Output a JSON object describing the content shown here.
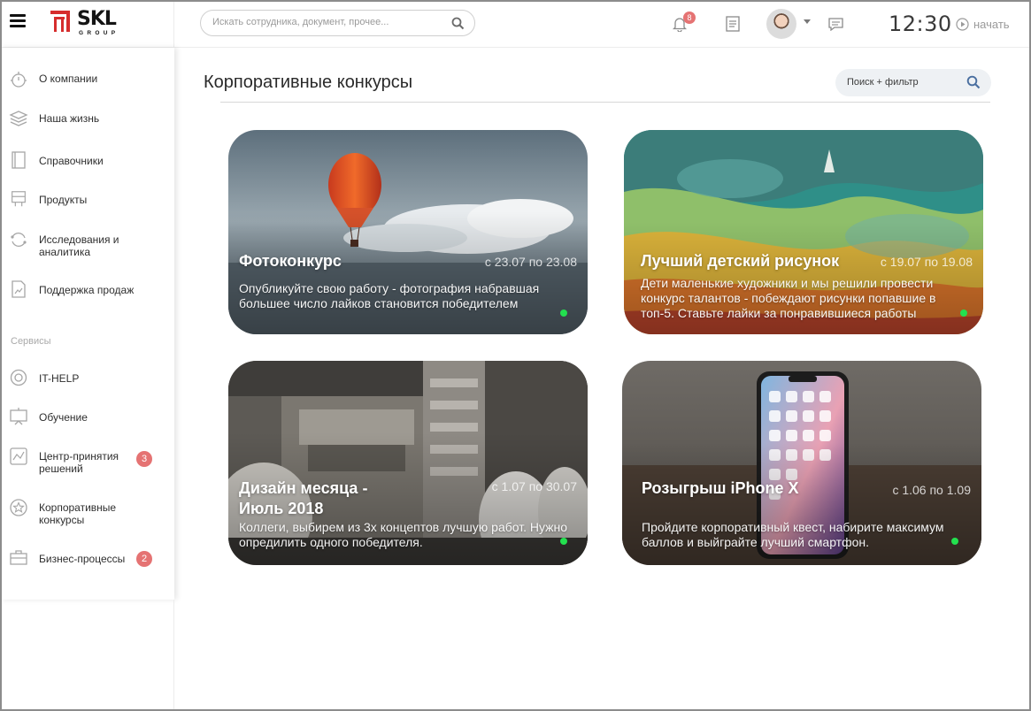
{
  "brand": {
    "name": "SKL",
    "sub": "GROUP"
  },
  "search": {
    "placeholder": "Искать сотрудника, документ, прочее..."
  },
  "header": {
    "notifications_count": "8",
    "clock": "12:30",
    "start_label": "начать"
  },
  "sidebar": {
    "items": [
      {
        "label": "О компании"
      },
      {
        "label": "Наша жизнь"
      },
      {
        "label": "Справочники"
      },
      {
        "label": "Продукты"
      },
      {
        "label": "Исследования и аналитика"
      },
      {
        "label": "Поддержка продаж"
      }
    ],
    "services_label": "Сервисы",
    "services": [
      {
        "label": "IT-HELP",
        "badge": ""
      },
      {
        "label": "Обучение",
        "badge": ""
      },
      {
        "label": "Центр-принятия решений",
        "badge": "3"
      },
      {
        "label": "Корпоративные конкурсы",
        "badge": ""
      },
      {
        "label": "Бизнес-процессы",
        "badge": "2"
      }
    ]
  },
  "main": {
    "title": "Корпоративные конкурсы",
    "filter_label": "Поиск + фильтр",
    "cards": [
      {
        "title": "Фотоконкурс",
        "date": "с 23.07 по 23.08",
        "description": "Опубликуйте свою работу - фотография набравшая большее число лайков становится победителем"
      },
      {
        "title": "Лучший детский рисунок",
        "date": "с 19.07 по 19.08",
        "description": "Дети маленькие художники и мы решили провести конкурс талантов - побеждают рисунки попавшие в топ-5. Ставьте лайки за понравившиеся работы"
      },
      {
        "title": "Дизайн месяца - Июль 2018",
        "date": "с 1.07 по 30.07",
        "description": "Коллеги, выбирем из 3х концептов лучшую работ. Нужно опредилить одного победителя."
      },
      {
        "title": "Розыгрыш iPhone X",
        "date": "с 1.06 по 1.09",
        "description": "Пройдите корпоративный квест, набирите максимум баллов и выйграйте лучший смартфон."
      }
    ]
  },
  "colors": {
    "badge": "#e57373",
    "active_dot": "#23e04f",
    "filter_bg": "#eef1f4"
  }
}
